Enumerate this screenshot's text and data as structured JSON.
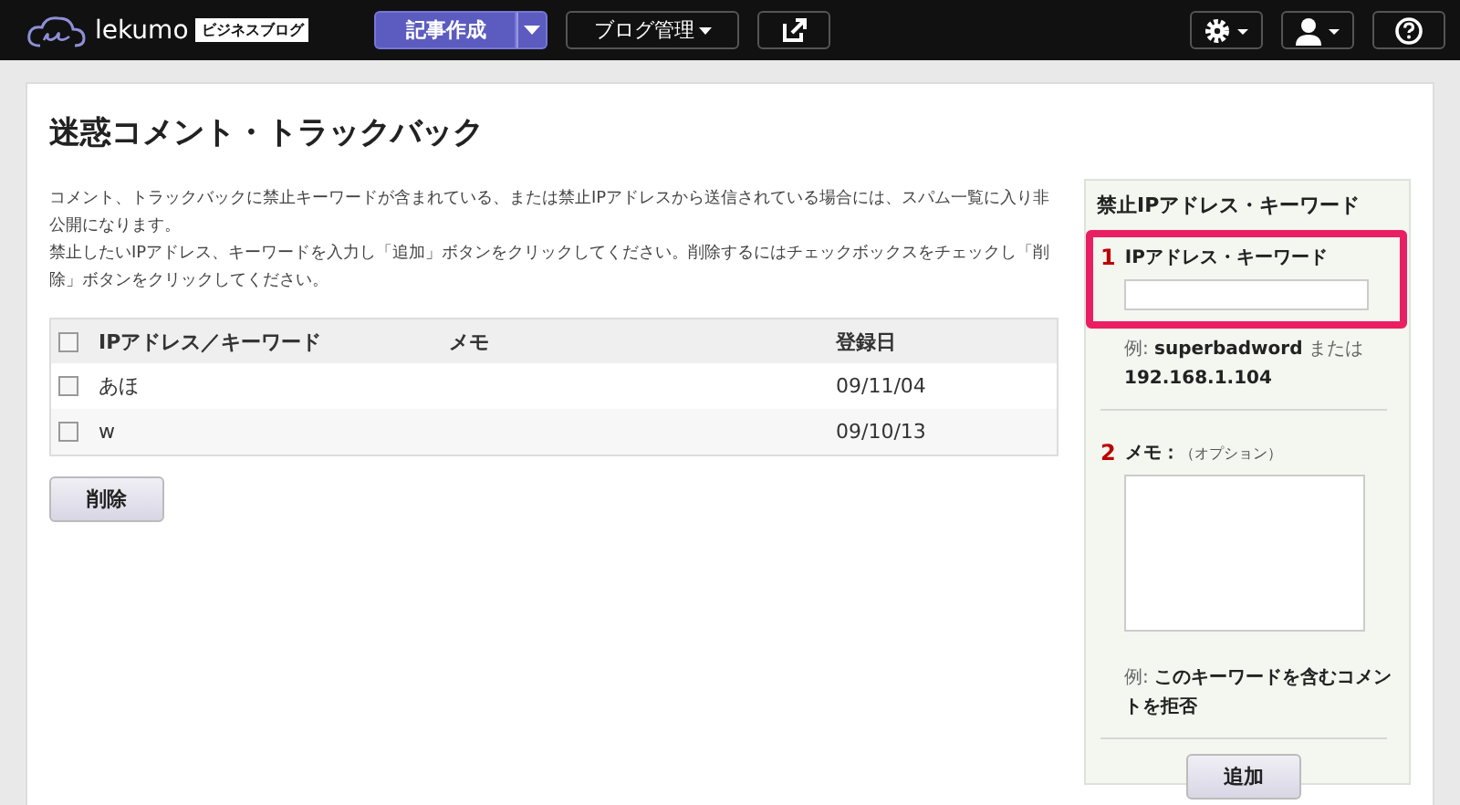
{
  "topbar": {
    "logo": "lekumo",
    "logo_badge": "ビジネスブログ",
    "compose_button": "記事作成",
    "blog_menu": "ブログ管理"
  },
  "page": {
    "title": "迷惑コメント・トラックバック",
    "description": [
      "コメント、トラックバックに禁止キーワードが含まれている、または禁止IPアドレスから送信されている場合には、スパム一覧に入り非公開になります。",
      "禁止したいIPアドレス、キーワードを入力し「追加」ボタンをクリックしてください。削除するにはチェックボックスをチェックし「削除」ボタンをクリックしてください。"
    ],
    "table": {
      "columns": [
        "IPアドレス／キーワード",
        "メモ",
        "登録日"
      ],
      "header_checked": false,
      "rows": [
        {
          "keyword": "あほ",
          "memo": "",
          "date": "09/11/04",
          "checked": false
        },
        {
          "keyword": "w",
          "memo": "",
          "date": "09/10/13",
          "checked": false
        }
      ]
    },
    "delete_button": "削除"
  },
  "panel": {
    "title": "禁止IPアドレス・キーワード",
    "steps": [
      {
        "number": "1",
        "kind": "input",
        "label": "IPアドレス・キーワード",
        "highlighted": true,
        "example": "例: **superbadword** または **192.168.1.104**"
      },
      {
        "number": "2",
        "kind": "textarea",
        "label": "メモ：",
        "note": "（オプション）",
        "highlighted": false,
        "example": "例: **このキーワードを含むコメントを拒否**"
      }
    ],
    "add_button": "追加"
  }
}
